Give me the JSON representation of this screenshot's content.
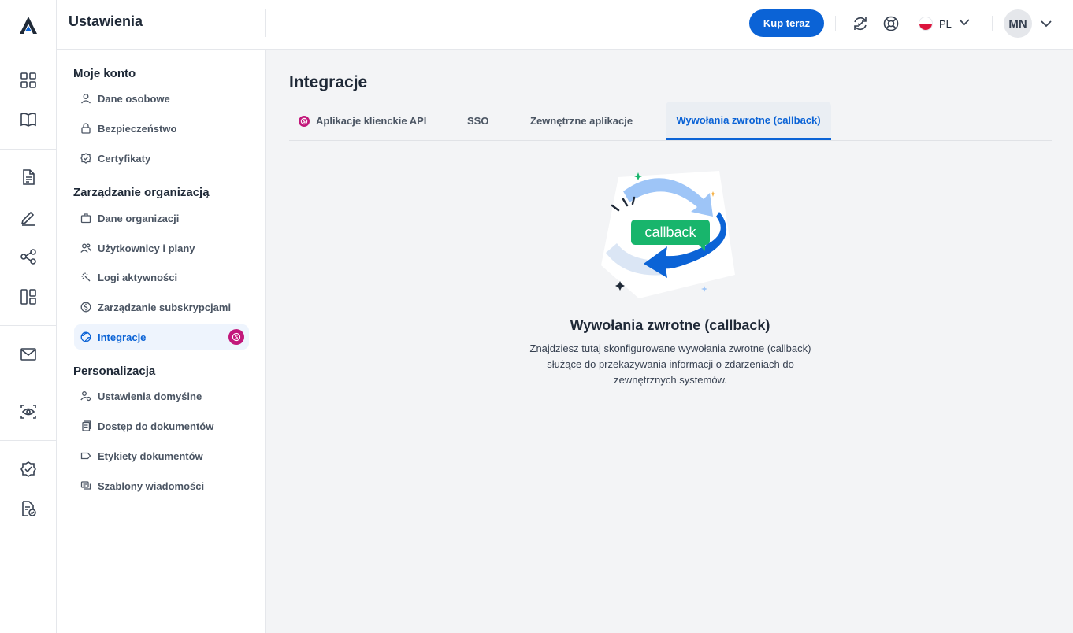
{
  "header": {
    "title": "Ustawienia",
    "buy_label": "Kup teraz",
    "lang_code": "PL",
    "avatar_initials": "MN"
  },
  "settings_nav": {
    "groups": [
      {
        "title": "Moje konto",
        "items": [
          {
            "label": "Dane osobowe",
            "icon": "user-icon"
          },
          {
            "label": "Bezpieczeństwo",
            "icon": "lock-icon"
          },
          {
            "label": "Certyfikaty",
            "icon": "certificate-icon"
          }
        ]
      },
      {
        "title": "Zarządzanie organizacją",
        "items": [
          {
            "label": "Dane organizacji",
            "icon": "briefcase-icon"
          },
          {
            "label": "Użytkownicy i plany",
            "icon": "users-icon"
          },
          {
            "label": "Logi aktywności",
            "icon": "activity-icon"
          },
          {
            "label": "Zarządzanie subskrypcjami",
            "icon": "coin-icon"
          },
          {
            "label": "Integracje",
            "icon": "globe-icon",
            "active": true,
            "badge": "pro-icon"
          }
        ]
      },
      {
        "title": "Personalizacja",
        "items": [
          {
            "label": "Ustawienia domyślne",
            "icon": "user-settings-icon"
          },
          {
            "label": "Dostęp do dokumentów",
            "icon": "documents-icon"
          },
          {
            "label": "Etykiety dokumentów",
            "icon": "tag-icon"
          },
          {
            "label": "Szablony wiadomości",
            "icon": "messages-icon"
          }
        ]
      }
    ]
  },
  "main": {
    "title": "Integracje",
    "tabs": [
      {
        "label": "Aplikacje klienckie API",
        "badge": "pro-icon"
      },
      {
        "label": "SSO"
      },
      {
        "label": "Zewnętrzne aplikacje"
      },
      {
        "label": "Wywołania zwrotne (callback)",
        "active": true
      }
    ],
    "empty_state": {
      "illustration_text": "callback",
      "title": "Wywołania zwrotne (callback)",
      "description": "Znajdziesz tutaj skonfigurowane wywołania zwrotne (callback) służące do przekazywania informacji o zdarzeniach do zewnętrznych systemów."
    }
  },
  "colors": {
    "accent": "#0b63d6",
    "pro_badge": "#c2187b",
    "callback_green": "#18b56c"
  }
}
